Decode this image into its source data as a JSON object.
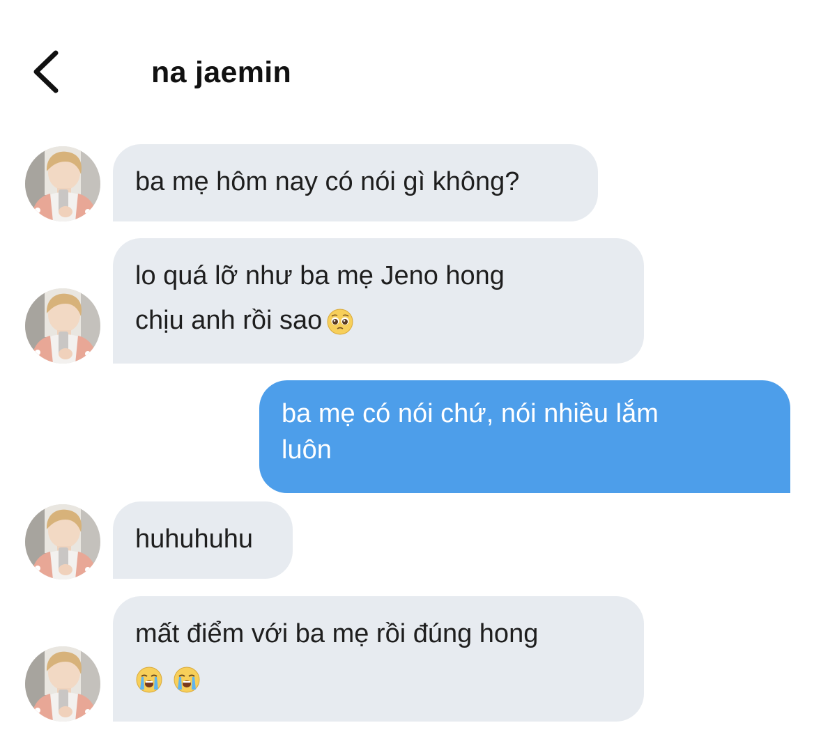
{
  "header": {
    "title": "na jaemin",
    "back_icon": "chevron-left-icon"
  },
  "messages": [
    {
      "direction": "incoming",
      "lines": [
        "ba mẹ hôm nay có nói gì không?"
      ],
      "emoji": []
    },
    {
      "direction": "incoming",
      "lines": [
        "lo quá lỡ như ba mẹ Jeno hong",
        "chịu anh rồi sao"
      ],
      "emoji": [
        "pleading-face-emoji"
      ]
    },
    {
      "direction": "outgoing",
      "lines": [
        "ba mẹ có nói chứ, nói nhiều lắm",
        "luôn"
      ],
      "emoji": []
    },
    {
      "direction": "incoming",
      "lines": [
        "huhuhuhu"
      ],
      "emoji": []
    },
    {
      "direction": "incoming",
      "lines": [
        "mất điểm với ba mẹ rồi đúng hong"
      ],
      "emoji": [
        "loudly-crying-face-emoji",
        "loudly-crying-face-emoji"
      ]
    }
  ],
  "colors": {
    "incoming_bubble": "#e7ebf0",
    "outgoing_bubble": "#4d9eea",
    "background": "#ffffff"
  }
}
